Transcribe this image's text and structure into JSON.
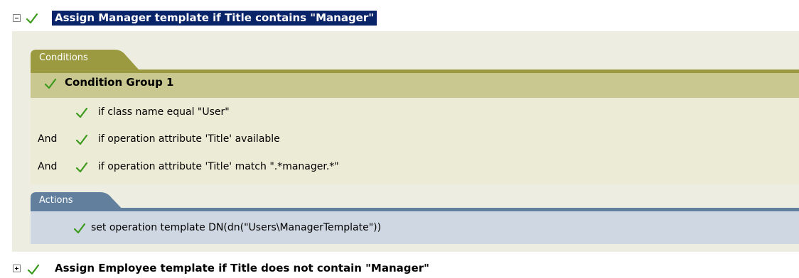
{
  "rules": [
    {
      "title": "Assign Manager template if Title contains \"Manager\"",
      "expanded": true,
      "selected": true
    },
    {
      "title": "Assign Employee template if Title does not contain \"Manager\"",
      "expanded": false,
      "selected": false
    }
  ],
  "conditions": {
    "tab_label": "Conditions",
    "group_label": "Condition Group 1",
    "items": [
      {
        "prefix": "",
        "text": "if class name equal \"User\""
      },
      {
        "prefix": "And",
        "text": "if operation attribute 'Title' available"
      },
      {
        "prefix": "And",
        "text": "if operation attribute 'Title' match \".*manager.*\""
      }
    ]
  },
  "actions": {
    "tab_label": "Actions",
    "items": [
      {
        "text": "set operation template DN(dn(\"Users\\ManagerTemplate\"))"
      }
    ]
  },
  "colors": {
    "check_green": "#3c9a1e",
    "conditions_accent": "#9b9a40",
    "actions_accent": "#62809e",
    "selection": "#0a246a"
  }
}
